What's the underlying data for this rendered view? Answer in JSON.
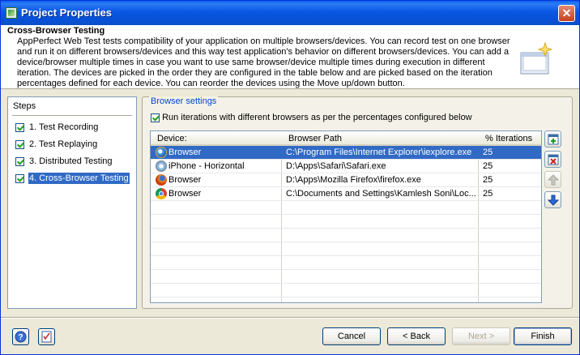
{
  "window": {
    "title": "Project Properties",
    "close_label": "✕"
  },
  "header": {
    "title": "Cross-Browser Testing",
    "description": "AppPerfect Web Test tests compatibility of your application on multiple browsers/devices. You can record test on one browser and run it on different browsers/devices and this way test application's behavior on different browsers/devices. You can add a device/browser multiple times in case you want to use same browser/device multiple times during execution in different iteration. The devices are picked in the order they are configured in the table below and are picked based on the iteration percentages defined for each device. You can reorder the devices using the Move up/down button."
  },
  "steps": {
    "title": "Steps",
    "items": [
      {
        "label": "1. Test Recording",
        "checked": true
      },
      {
        "label": "2. Test Replaying",
        "checked": true
      },
      {
        "label": "3. Distributed Testing",
        "checked": true
      },
      {
        "label": "4. Cross-Browser Testing",
        "checked": true,
        "active": true
      }
    ]
  },
  "browser_settings": {
    "legend": "Browser settings",
    "run_iterations_label": "Run iterations with different browsers as per the percentages configured below",
    "columns": [
      "Device:",
      "Browser Path",
      "% Iterations"
    ],
    "rows": [
      {
        "icon": "ie-icon",
        "device": "Browser",
        "path": "C:\\Program Files\\Internet Explorer\\iexplore.exe",
        "iterations": "25"
      },
      {
        "icon": "safari-icon",
        "device": "iPhone  - Horizontal",
        "path": "D:\\Apps\\Safari\\Safari.exe",
        "iterations": "25"
      },
      {
        "icon": "firefox-icon",
        "device": "Browser",
        "path": "D:\\Apps\\Mozilla Firefox\\firefox.exe",
        "iterations": "25"
      },
      {
        "icon": "chrome-icon",
        "device": "Browser",
        "path": "C:\\Documents and Settings\\Kamlesh Soni\\Loc...",
        "iterations": "25"
      }
    ]
  },
  "buttons": {
    "cancel": "Cancel",
    "back": "< Back",
    "next": "Next >",
    "finish": "Finish"
  },
  "colors": {
    "selection": "#316ac5",
    "titlebar": "#0a57e5",
    "legend": "#0046d5"
  }
}
